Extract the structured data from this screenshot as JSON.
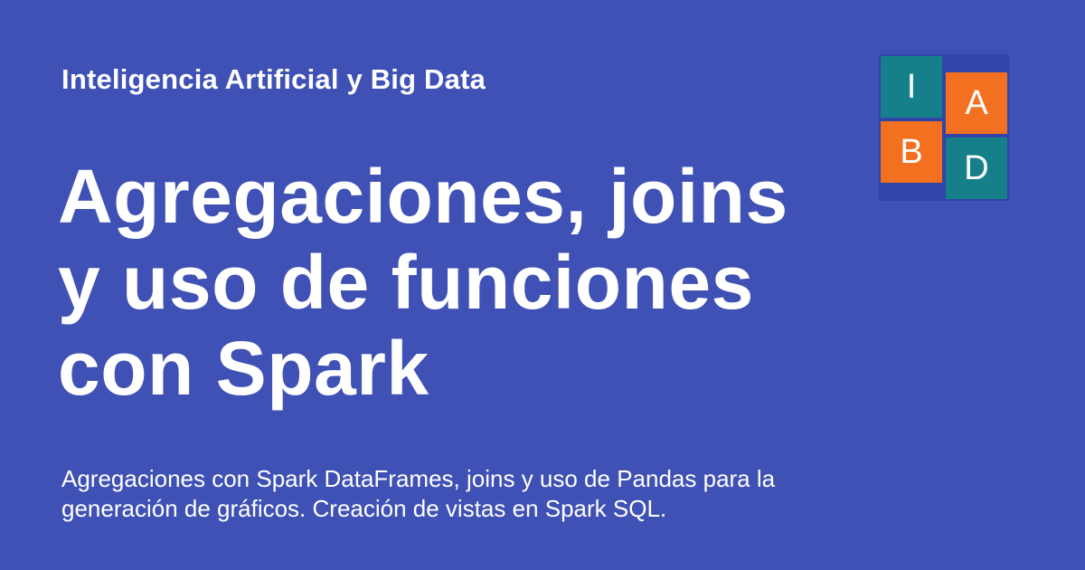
{
  "header": {
    "site_name": "Inteligencia Artificial y Big Data"
  },
  "main": {
    "title": "Agregaciones, joins y uso de funciones con Spark",
    "description": "Agregaciones con Spark DataFrames, joins y uso de Pandas para la generación de gráficos. Creación de vistas en Spark SQL."
  },
  "logo": {
    "tiles": [
      {
        "letter": "I",
        "color": "#16808a"
      },
      {
        "letter": "A",
        "color": "#f37021"
      },
      {
        "letter": "B",
        "color": "#f37021"
      },
      {
        "letter": "D",
        "color": "#16808a"
      }
    ]
  },
  "colors": {
    "background": "#3f51b5",
    "teal": "#16808a",
    "orange": "#f37021",
    "text": "#ffffff"
  }
}
